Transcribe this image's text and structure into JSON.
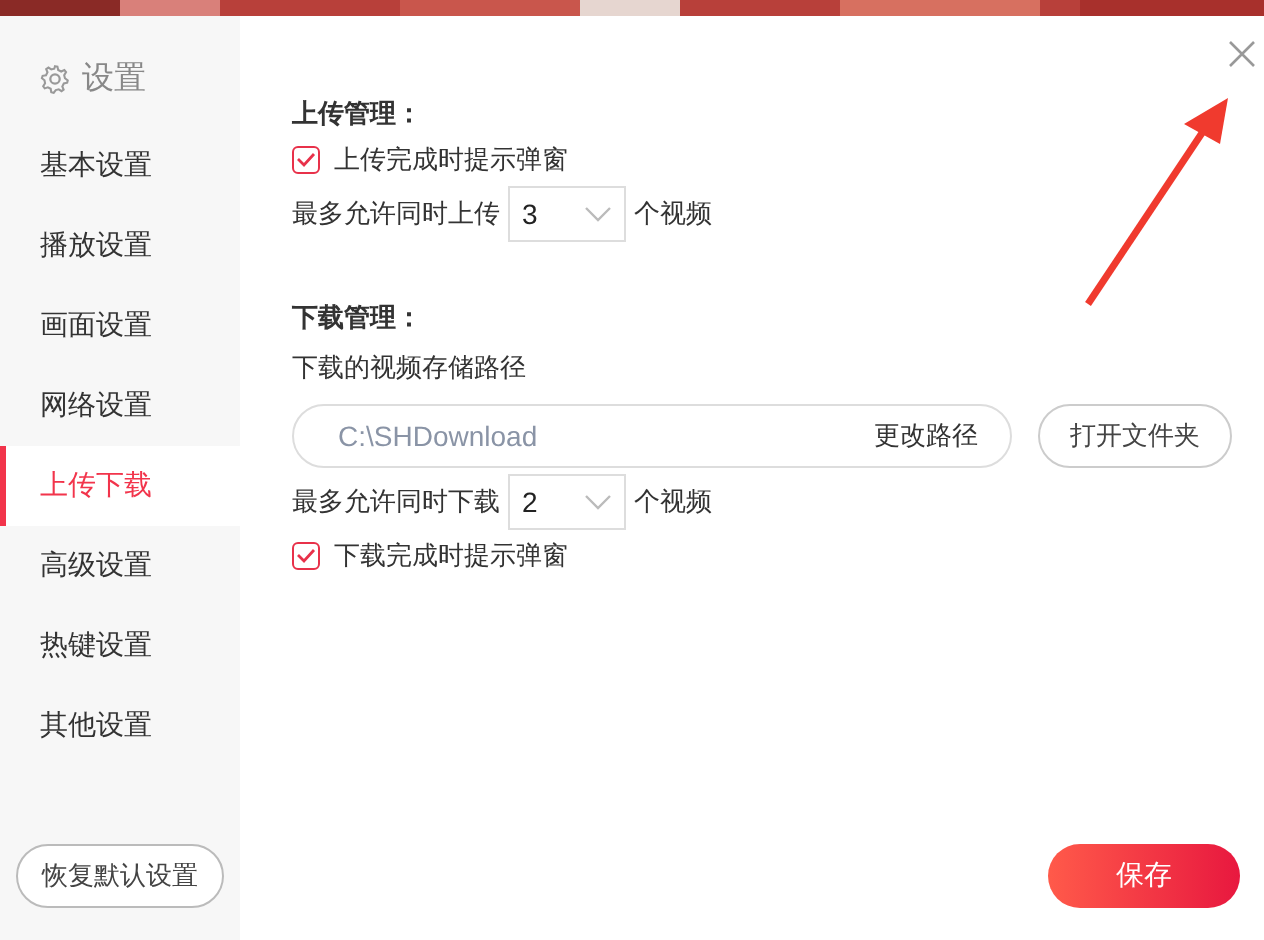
{
  "sidebar": {
    "title": "设置",
    "items": [
      {
        "label": "基本设置",
        "selected": false
      },
      {
        "label": "播放设置",
        "selected": false
      },
      {
        "label": "画面设置",
        "selected": false
      },
      {
        "label": "网络设置",
        "selected": false
      },
      {
        "label": "上传下载",
        "selected": true
      },
      {
        "label": "高级设置",
        "selected": false
      },
      {
        "label": "热键设置",
        "selected": false
      },
      {
        "label": "其他设置",
        "selected": false
      }
    ],
    "reset_button": "恢复默认设置"
  },
  "upload": {
    "heading": "上传管理：",
    "notify": {
      "label": "上传完成时提示弹窗",
      "checked": true
    },
    "limit": {
      "label": "最多允许同时上传",
      "value": "3",
      "unit": "个视频"
    }
  },
  "download": {
    "heading": "下载管理：",
    "path_label": "下载的视频存储路径",
    "path": "C:\\SHDownload",
    "change_path": "更改路径",
    "open_folder": "打开文件夹",
    "limit": {
      "label": "最多允许同时下载",
      "value": "2",
      "unit": "个视频"
    },
    "notify": {
      "label": "下载完成时提示弹窗",
      "checked": true
    }
  },
  "save_button": "保存"
}
